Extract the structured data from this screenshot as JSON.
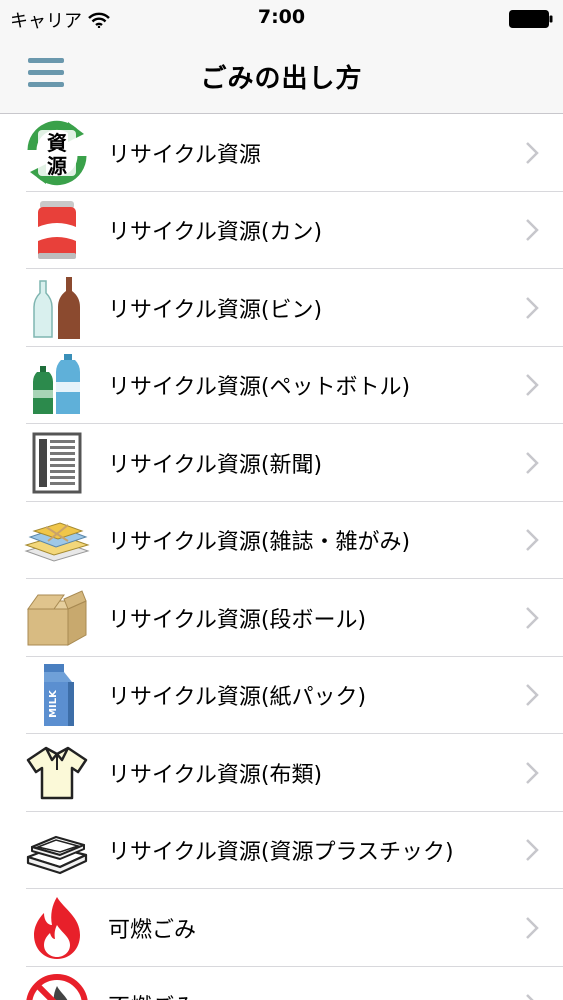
{
  "status_bar": {
    "carrier": "キャリア",
    "time": "7:00"
  },
  "nav": {
    "title": "ごみの出し方",
    "menu_icon": "hamburger-menu-icon"
  },
  "items": [
    {
      "label": "リサイクル資源",
      "icon": "recycle-resource-icon",
      "icon_text_top": "資",
      "icon_text_bottom": "源"
    },
    {
      "label": "リサイクル資源(カン)",
      "icon": "can-icon"
    },
    {
      "label": "リサイクル資源(ビン)",
      "icon": "bottle-icon"
    },
    {
      "label": "リサイクル資源(ペットボトル)",
      "icon": "pet-bottle-icon"
    },
    {
      "label": "リサイクル資源(新聞)",
      "icon": "newspaper-icon"
    },
    {
      "label": "リサイクル資源(雑誌・雑がみ)",
      "icon": "magazine-icon"
    },
    {
      "label": "リサイクル資源(段ボール)",
      "icon": "cardboard-box-icon"
    },
    {
      "label": "リサイクル資源(紙パック)",
      "icon": "milk-carton-icon",
      "icon_text": "MILK"
    },
    {
      "label": "リサイクル資源(布類)",
      "icon": "shirt-icon"
    },
    {
      "label": "リサイクル資源(資源プラスチック)",
      "icon": "plastic-tray-icon"
    },
    {
      "label": "可燃ごみ",
      "icon": "fire-icon"
    },
    {
      "label": "不燃ごみ",
      "icon": "no-burn-icon"
    }
  ],
  "colors": {
    "menu_icon": "#6a98ad",
    "chevron": "#c7c7cc",
    "separator": "#d8d8dc",
    "recycle_green": "#3aa14a",
    "fire_red": "#e8202a"
  }
}
